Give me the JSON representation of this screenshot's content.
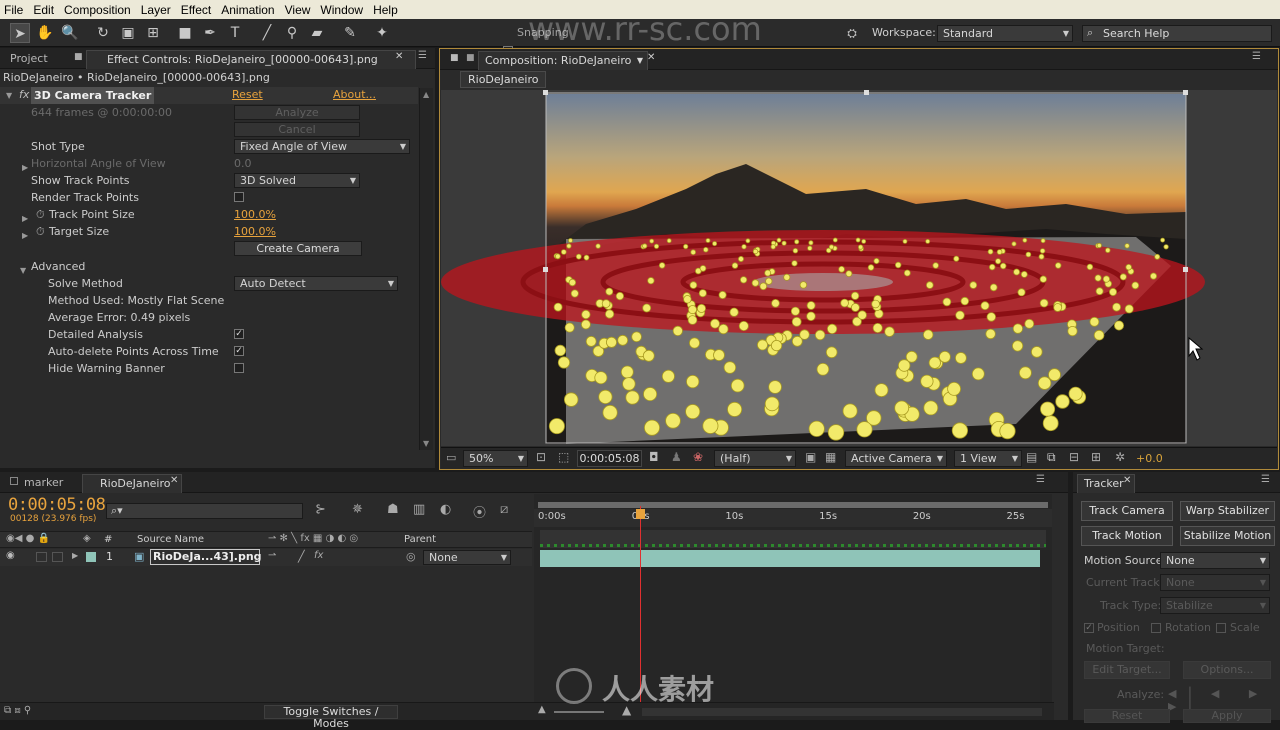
{
  "menu": [
    "File",
    "Edit",
    "Composition",
    "Layer",
    "Effect",
    "Animation",
    "View",
    "Window",
    "Help"
  ],
  "toolbar": {
    "snapping_label": "Snapping",
    "workspace_label": "Workspace:",
    "workspace_value": "Standard",
    "search_placeholder": "Search Help"
  },
  "watermark": {
    "url": "www.rr-sc.com",
    "brand": "人人素材"
  },
  "left_panel": {
    "tab_project": "Project",
    "tab_effect": "Effect Controls: RioDeJaneiro_[00000-00643].png",
    "breadcrumb": "RioDeJaneiro • RioDeJaneiro_[00000-00643].png",
    "effect_name": "3D Camera Tracker",
    "reset": "Reset",
    "about": "About...",
    "frames_info": "644 frames @ 0:00:00:00",
    "analyze": "Analyze",
    "cancel": "Cancel",
    "shot_type_label": "Shot Type",
    "shot_type_value": "Fixed Angle of View",
    "hangle_label": "Horizontal Angle of View",
    "hangle_value": "0.0",
    "show_points_label": "Show Track Points",
    "show_points_value": "3D Solved",
    "render_points_label": "Render Track Points",
    "track_point_size_label": "Track Point Size",
    "track_point_size_value": "100.0%",
    "target_size_label": "Target Size",
    "target_size_value": "100.0%",
    "create_camera": "Create Camera",
    "advanced_label": "Advanced",
    "solve_method_label": "Solve Method",
    "solve_method_value": "Auto Detect",
    "method_used": "Method Used: Mostly Flat Scene",
    "avg_error": "Average Error: 0.49 pixels",
    "detailed_analysis_label": "Detailed Analysis",
    "auto_delete_label": "Auto-delete Points Across Time",
    "hide_warning_label": "Hide Warning Banner",
    "render_points_checked": false,
    "detailed_analysis_checked": true,
    "auto_delete_checked": true,
    "hide_warning_checked": false
  },
  "composition": {
    "tab_label": "Composition: RioDeJaneiro",
    "subtab": "RioDeJaneiro",
    "zoom": "50%",
    "timecode": "0:00:05:08",
    "resolution": "(Half)",
    "camera": "Active Camera",
    "views": "1 View",
    "exposure": "+0.0"
  },
  "timeline": {
    "tab_marker": "marker",
    "tab_comp": "RioDeJaneiro",
    "timecode": "0:00:05:08",
    "frame_info": "00128 (23.976 fps)",
    "col_num": "#",
    "col_source": "Source Name",
    "col_parent": "Parent",
    "layer_num": "1",
    "layer_name": "RioDeJa...43].png",
    "parent_value": "None",
    "ruler": [
      "0:00s",
      "05s",
      "10s",
      "15s",
      "20s",
      "25s"
    ],
    "toggle_label": "Toggle Switches / Modes",
    "playhead_time_s": 5.33,
    "duration_s": 27
  },
  "tracker": {
    "title": "Tracker",
    "track_camera": "Track Camera",
    "warp_stabilizer": "Warp Stabilizer",
    "track_motion": "Track Motion",
    "stabilize_motion": "Stabilize Motion",
    "motion_source_label": "Motion Source:",
    "motion_source_value": "None",
    "current_track_label": "Current Track:",
    "current_track_value": "None",
    "track_type_label": "Track Type:",
    "track_type_value": "Stabilize",
    "position": "Position",
    "rotation": "Rotation",
    "scale": "Scale",
    "motion_target_label": "Motion Target:",
    "edit_target": "Edit Target...",
    "options": "Options...",
    "analyze_label": "Analyze:",
    "reset": "Reset",
    "apply": "Apply"
  }
}
